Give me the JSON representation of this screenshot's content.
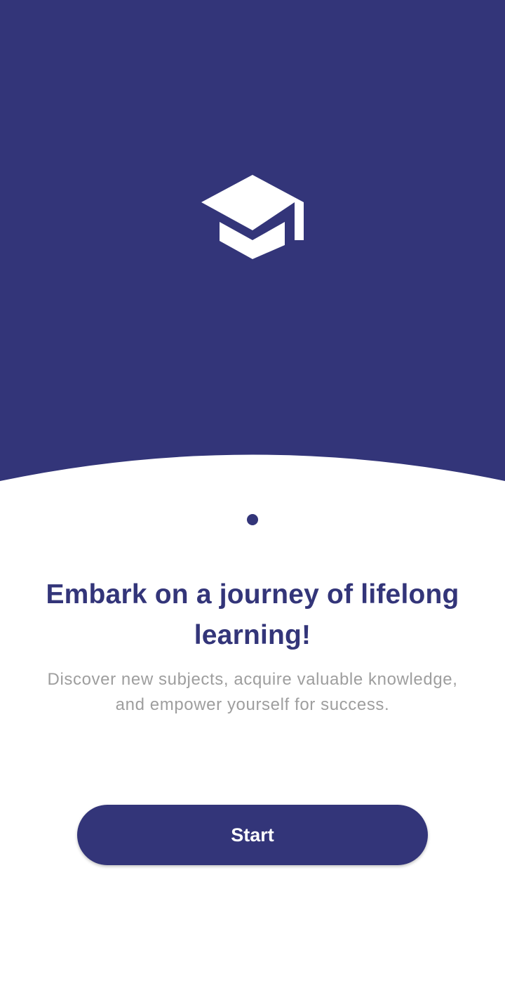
{
  "theme": {
    "primary": "#333579",
    "background": "#ffffff",
    "subtitle_color": "#9e9e9e",
    "icon_color": "#ffffff"
  },
  "hero": {
    "icon": "graduation-cap-icon"
  },
  "pager": {
    "count": 1,
    "active_index": 0
  },
  "content": {
    "title": "Embark on a journey of lifelong learning!",
    "subtitle": "Discover new subjects, acquire valuable knowledge, and empower yourself for success."
  },
  "actions": {
    "start_label": "Start"
  }
}
